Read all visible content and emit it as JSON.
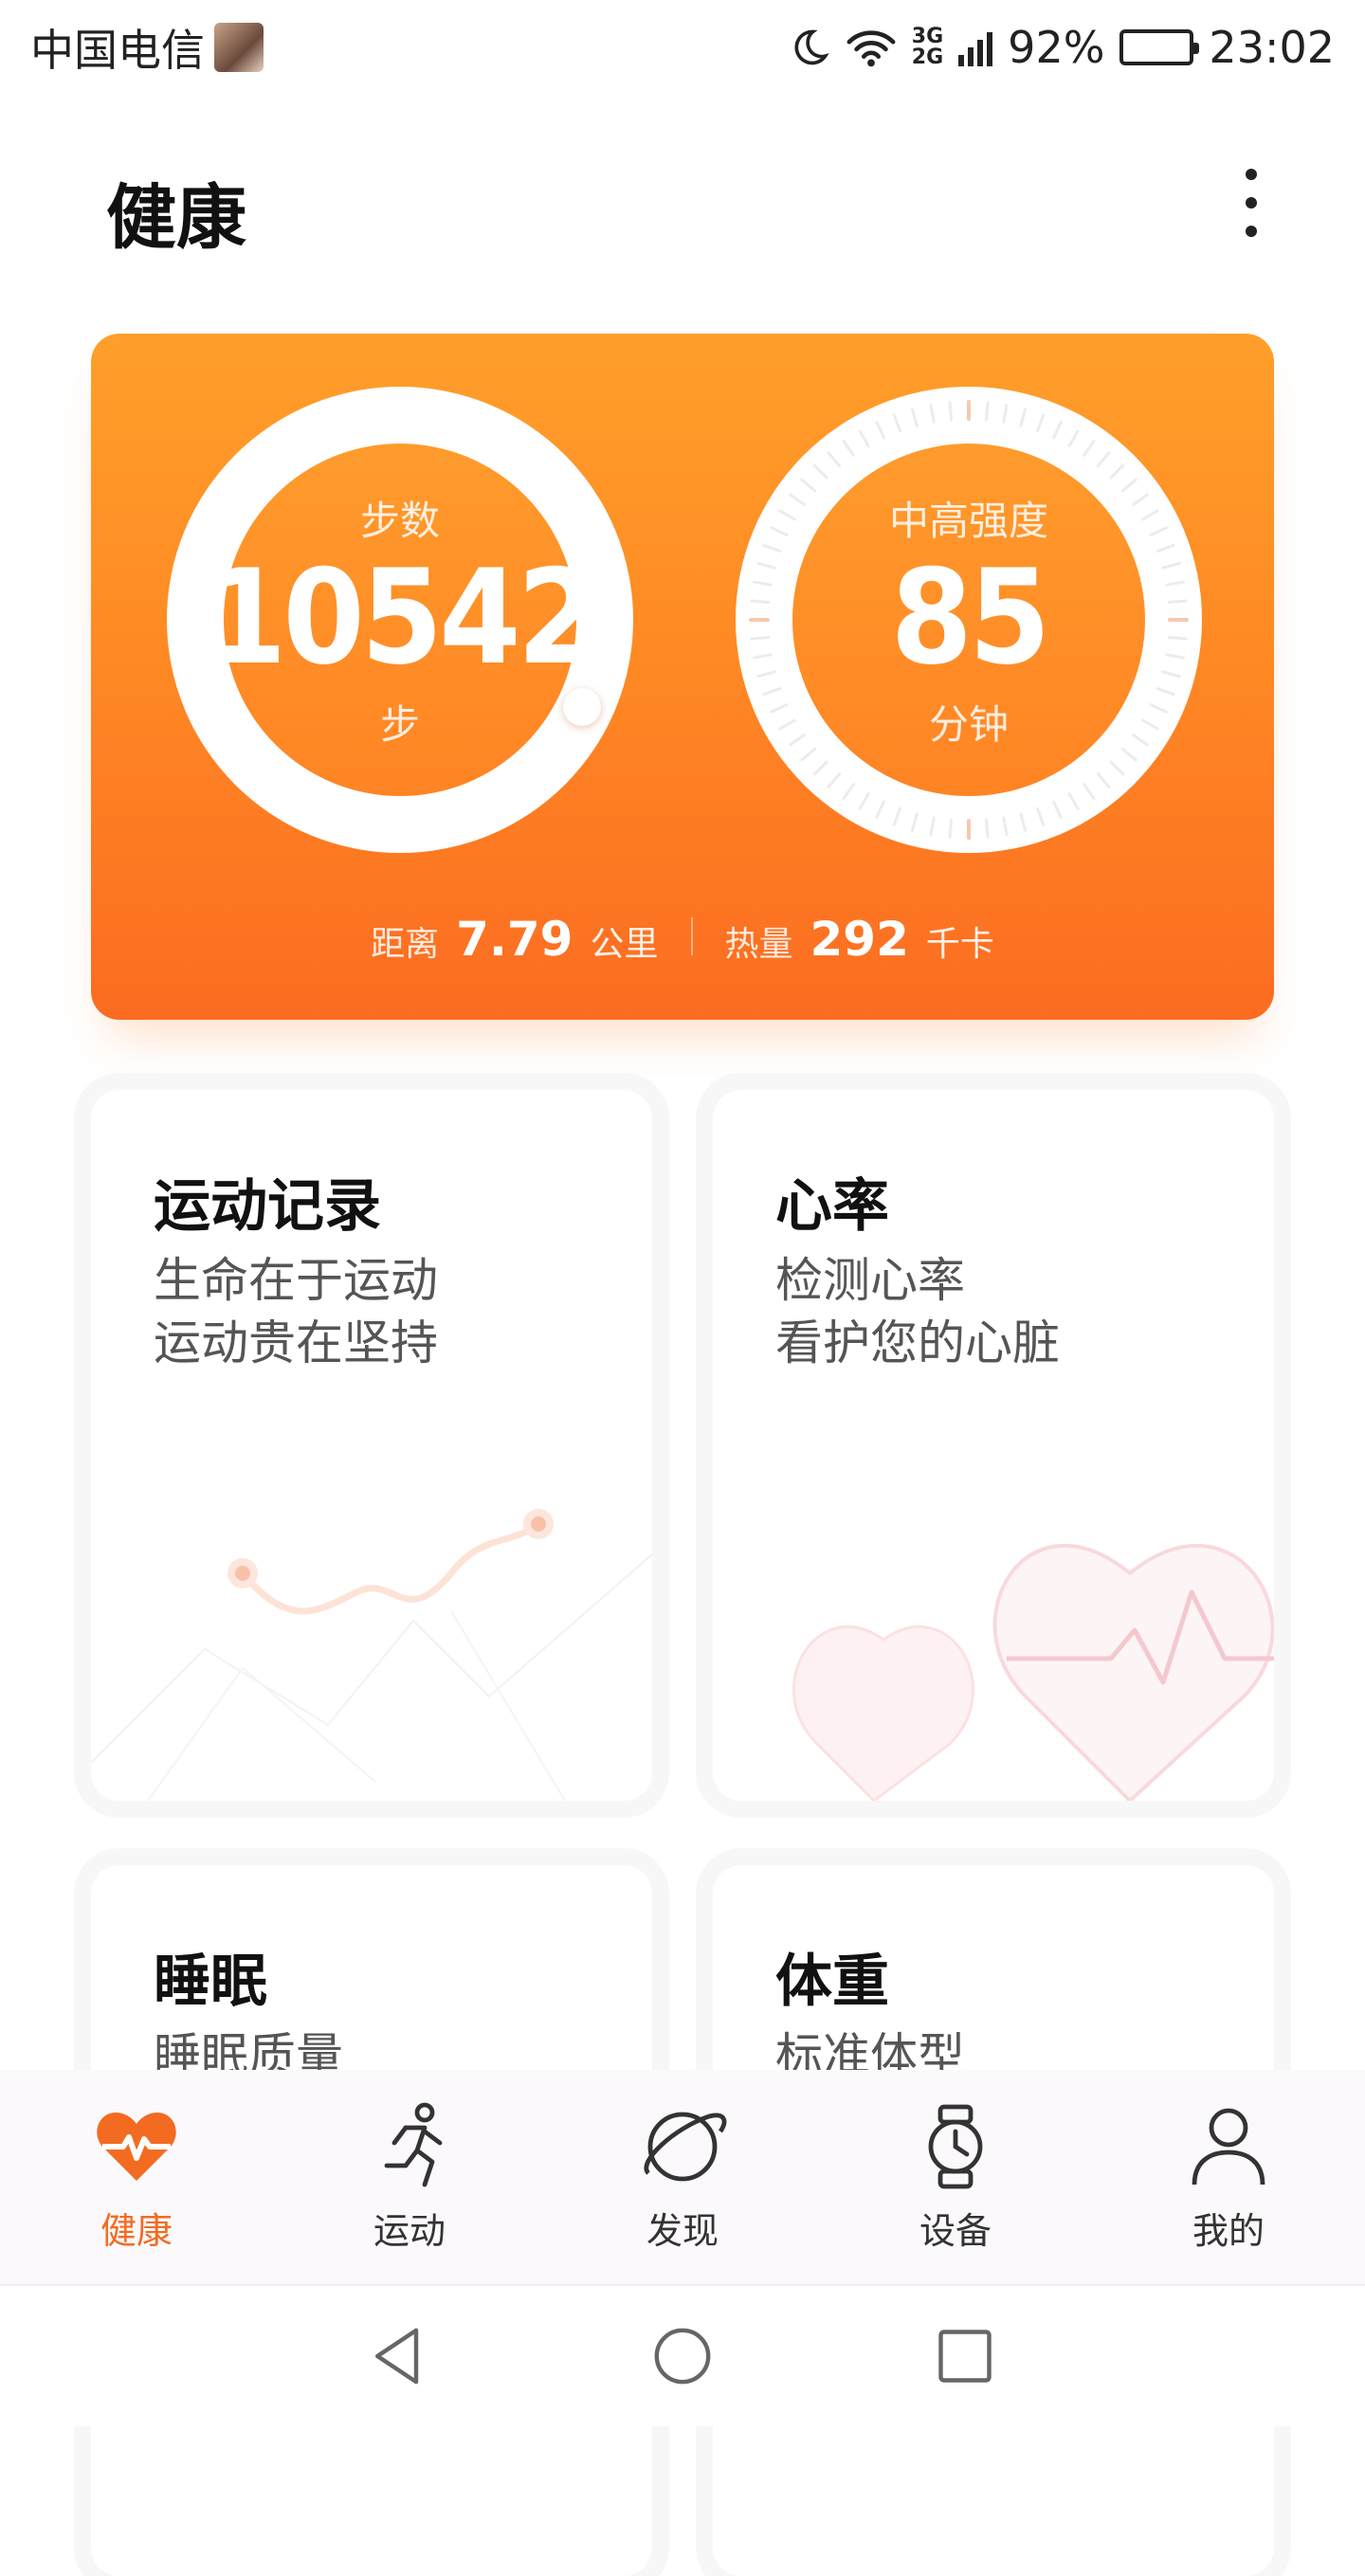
{
  "status_bar": {
    "carrier": "中国电信",
    "network": "3G\n2G",
    "battery_percent": "92%",
    "time": "23:02"
  },
  "header": {
    "title": "健康"
  },
  "summary_card": {
    "steps": {
      "label": "步数",
      "value": "10542",
      "unit": "步"
    },
    "intensity": {
      "label": "中高强度",
      "value": "85",
      "unit": "分钟"
    },
    "distance": {
      "label": "距离",
      "value": "7.79",
      "unit": "公里"
    },
    "calories": {
      "label": "热量",
      "value": "292",
      "unit": "千卡"
    }
  },
  "cards": [
    {
      "title": "运动记录",
      "subtitle": "生命在于运动\n运动贵在坚持"
    },
    {
      "title": "心率",
      "subtitle": "检测心率\n看护您的心脏"
    },
    {
      "title": "睡眠",
      "subtitle": "睡眠质量"
    },
    {
      "title": "体重",
      "subtitle": "标准体型"
    }
  ],
  "tabs": [
    {
      "label": "健康",
      "icon": "heart-pulse-icon",
      "active": true
    },
    {
      "label": "运动",
      "icon": "running-icon",
      "active": false
    },
    {
      "label": "发现",
      "icon": "planet-icon",
      "active": false
    },
    {
      "label": "设备",
      "icon": "watch-icon",
      "active": false
    },
    {
      "label": "我的",
      "icon": "person-icon",
      "active": false
    }
  ],
  "colors": {
    "accent": "#f36b21",
    "card_orange_top": "#ff9f2a",
    "card_orange_bottom": "#fb6c21"
  }
}
